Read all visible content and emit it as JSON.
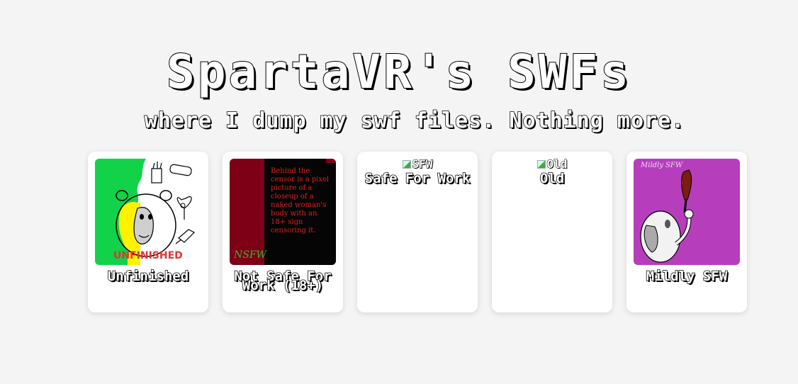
{
  "header": {
    "title": "SpartaVR's SWFs",
    "subtitle": "where I dump my swf files. Nothing more."
  },
  "cards": [
    {
      "label": "Unfinished",
      "image_text": "UNFINISHED"
    },
    {
      "label": "Not Safe For Work (18+)",
      "image_text": "Behind the censor is a pixel picture of a closeup of a naked woman's body with an 18+ sign censoring it.",
      "image_mark": "NSFW"
    },
    {
      "label": "Safe For Work",
      "image_alt": "SFW"
    },
    {
      "label": "Old",
      "image_alt": "Old"
    },
    {
      "label": "Mildly SFW",
      "image_mark": "Mildly SFW"
    }
  ],
  "colors": {
    "background": "#f4f4f4",
    "card": "#ffffff",
    "unfinished_green": "#12d24a",
    "unfinished_yellow": "#fff200",
    "nsfw_red": "#7d0016",
    "mildly_purple": "#b63ebd"
  }
}
